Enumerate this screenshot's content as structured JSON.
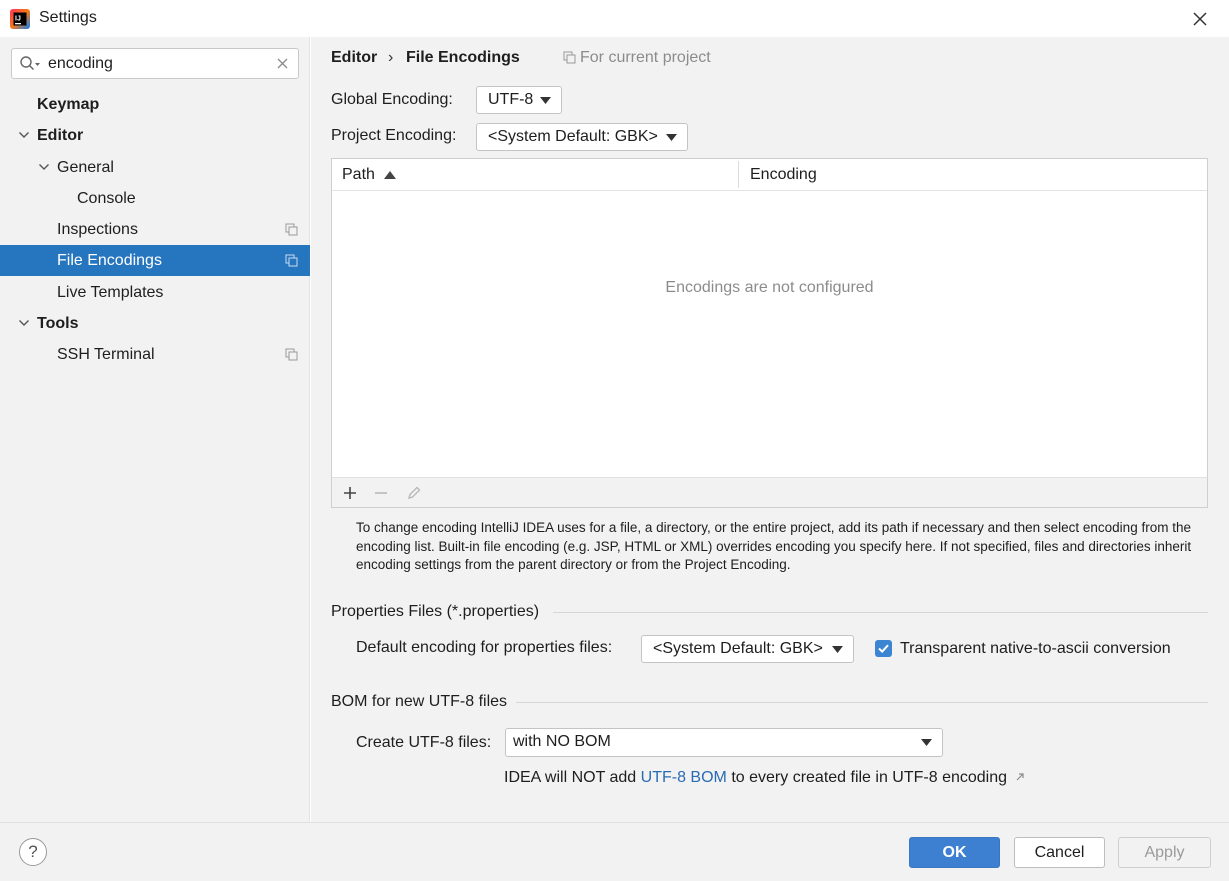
{
  "window": {
    "title": "Settings",
    "app_icon": "intellij-idea-icon",
    "close_icon": "close-icon"
  },
  "search": {
    "value": "encoding",
    "icon": "search-icon",
    "clear_icon": "clear-icon"
  },
  "tree": {
    "keymap": "Keymap",
    "editor": "Editor",
    "general": "General",
    "console": "Console",
    "inspections": "Inspections",
    "file_encodings": "File Encodings",
    "live_templates": "Live Templates",
    "tools": "Tools",
    "ssh_terminal": "SSH Terminal"
  },
  "breadcrumb": {
    "parent": "Editor",
    "separator": "›",
    "current": "File Encodings",
    "scope": "For current project"
  },
  "global_encoding": {
    "label": "Global Encoding:",
    "value": "UTF-8"
  },
  "project_encoding": {
    "label": "Project Encoding:",
    "value": "<System Default: GBK>"
  },
  "table": {
    "columns": [
      "Path",
      "Encoding"
    ],
    "sort_column": "Path",
    "empty_text": "Encodings are not configured",
    "toolbar": [
      "add-icon",
      "remove-icon",
      "edit-icon"
    ]
  },
  "help_text": "To change encoding IntelliJ IDEA uses for a file, a directory, or the entire project, add its path if necessary and then select encoding from the encoding list. Built-in file encoding (e.g. JSP, HTML or XML) overrides encoding you specify here. If not specified, files and directories inherit encoding settings from the parent directory or from the Project Encoding.",
  "properties_section": {
    "title": "Properties Files (*.properties)",
    "default_label": "Default encoding for properties files:",
    "default_value": "<System Default: GBK>",
    "transparent_label": "Transparent native-to-ascii conversion",
    "transparent_checked": true
  },
  "bom_section": {
    "title": "BOM for new UTF-8 files",
    "create_label": "Create UTF-8 files:",
    "create_value": "with NO BOM",
    "note_prefix": "IDEA will NOT add",
    "note_link": "UTF-8 BOM",
    "note_suffix": "to every created file in UTF-8 encoding"
  },
  "footer": {
    "help": "?",
    "ok": "OK",
    "cancel": "Cancel",
    "apply": "Apply"
  },
  "colors": {
    "accent": "#2675bf",
    "ok_button": "#3d7fd1",
    "link": "#2a6bb3",
    "panel_bg": "#f2f2f2"
  }
}
